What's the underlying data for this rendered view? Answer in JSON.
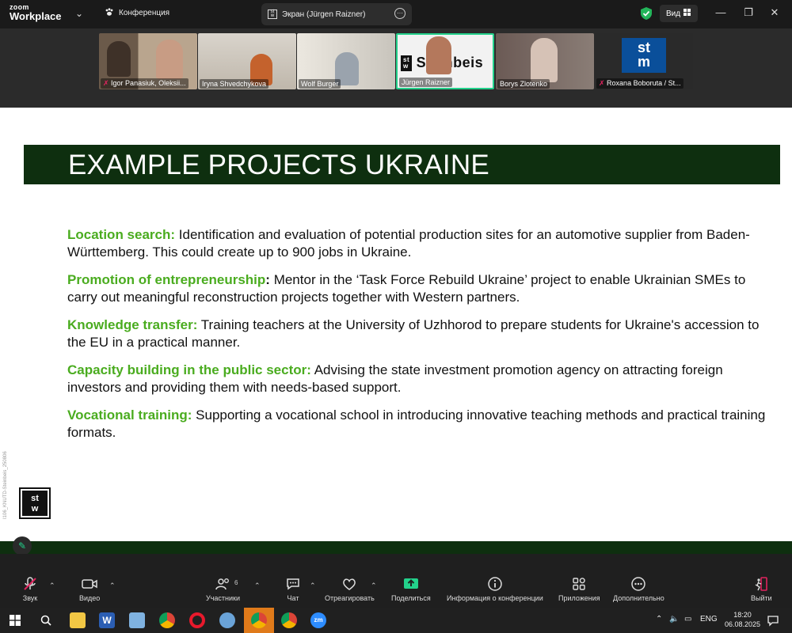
{
  "app": {
    "logo_line1": "zoom",
    "logo_line2": "Workplace"
  },
  "tabs": {
    "conference": "Конференция",
    "screen": "Экран (Jürgen Raizner)"
  },
  "view_label": "Вид",
  "participants_strip": [
    {
      "name": "Igor Panasiuk, Oleksii...",
      "muted": true
    },
    {
      "name": "Iryna Shvedchykova",
      "muted": false
    },
    {
      "name": "Wolf Burger",
      "muted": false
    },
    {
      "name": "Jürgen Raizner",
      "muted": false,
      "active": true
    },
    {
      "name": "Borys Zlotenko",
      "muted": false
    },
    {
      "name": "Roxana Boboruta / St...",
      "muted": true
    }
  ],
  "tile_logo": {
    "brand": "Steinbeis",
    "mark1": "st",
    "mark2": "m"
  },
  "slide": {
    "title": "EXAMPLE PROJECTS UKRAINE",
    "side_text": "I106_KNUTD-Steinbeis_250806",
    "logo": {
      "top": "st",
      "bottom": "w"
    },
    "items": [
      {
        "heading": "Location search:",
        "text": " Identification and evaluation of potential production sites for an automotive supplier from Baden-Württemberg. This could create up to 900 jobs in Ukraine."
      },
      {
        "heading": "Promotion of entrepreneurship",
        "colon": ":",
        "text": " Mentor in the ‘Task Force Rebuild Ukraine’ project to enable Ukrainian SMEs to carry out meaningful reconstruction projects together with Western partners."
      },
      {
        "heading": "Knowledge transfer:",
        "text": " Training teachers at the University of Uzhhorod to prepare students for Ukraine's accession to the EU in a practical manner."
      },
      {
        "heading": "Capacity building in the public sector:",
        "text": " Advising the state investment promotion agency on attracting foreign investors and providing them with needs-based support."
      },
      {
        "heading": "Vocational training:",
        "text": " Supporting a vocational school in introducing innovative teaching methods and practical training formats."
      }
    ]
  },
  "toolbar": {
    "audio": "Звук",
    "video": "Видео",
    "participants": "Участники",
    "participants_count": "6",
    "chat": "Чат",
    "react": "Отреагировать",
    "share": "Поделиться",
    "info": "Информация о конференции",
    "apps": "Приложения",
    "more": "Дополнительно",
    "leave": "Выйти"
  },
  "taskbar": {
    "lang": "ENG",
    "time": "18:20",
    "date": "06.08.2025",
    "zm": "zm"
  },
  "colors": {
    "accent_green": "#4aac1f",
    "banner": "#0e2f0f",
    "active_tile": "#23d18b",
    "muted_red": "#e0245e"
  }
}
